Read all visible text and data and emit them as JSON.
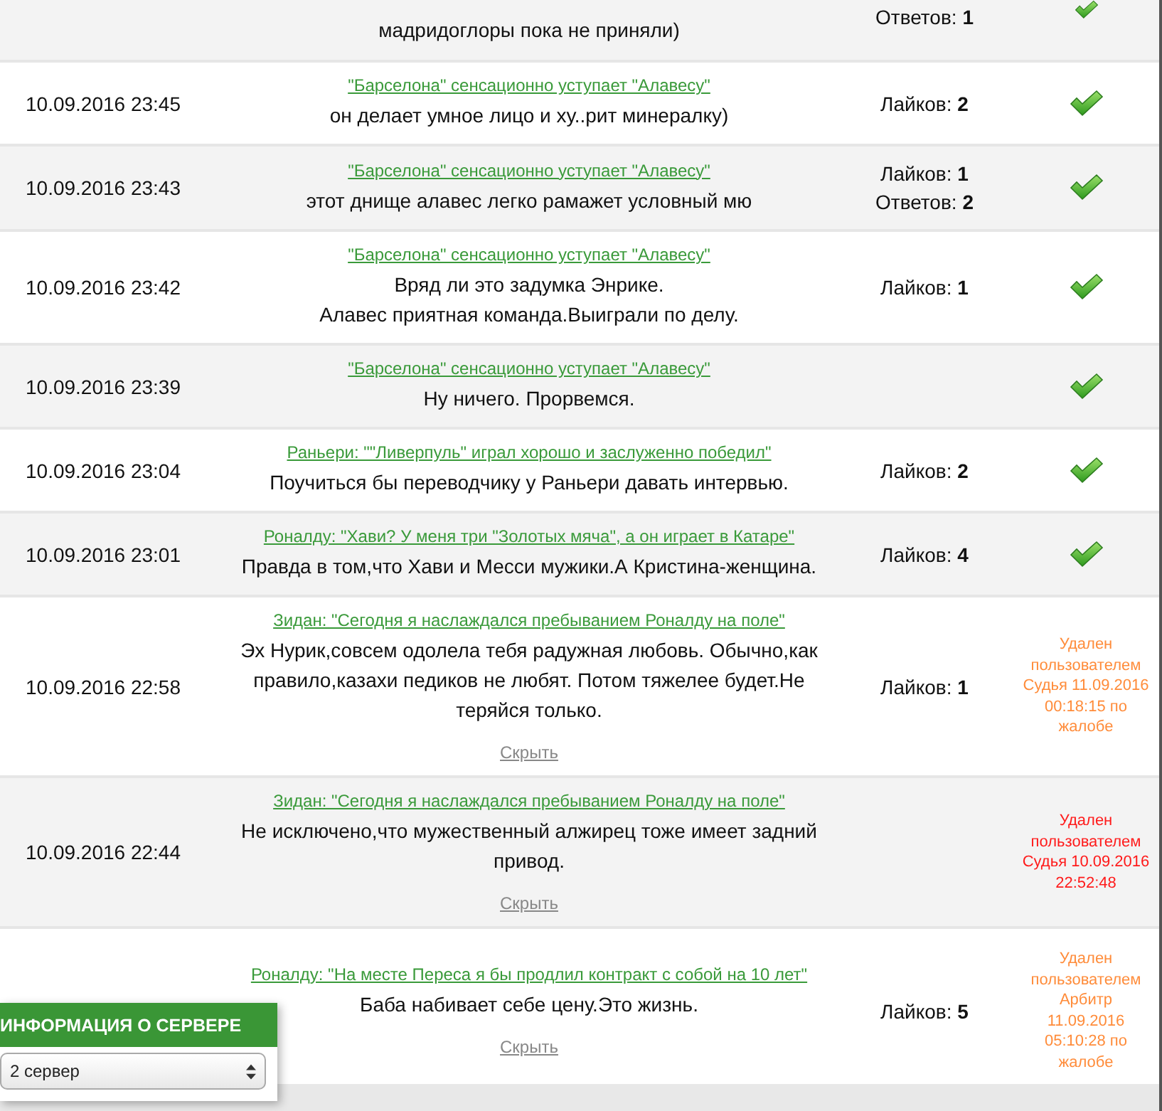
{
  "comments": [
    {
      "text": "мадридоглоры пока не приняли)",
      "stats": [
        {
          "label": "Ответов:",
          "value": "1"
        }
      ],
      "status": {
        "kind": "approved"
      },
      "partial": true
    },
    {
      "date": "10.09.2016 23:45",
      "topic": "\"Барселона\" сенсационно уступает \"Алавесу\"",
      "text": "он делает умное лицо и ху..рит минералку)",
      "stats": [
        {
          "label": "Лайков:",
          "value": "2"
        }
      ],
      "status": {
        "kind": "approved"
      }
    },
    {
      "date": "10.09.2016 23:43",
      "topic": "\"Барселона\" сенсационно уступает \"Алавесу\"",
      "text": "этот днище алавес легко рамажет условный мю",
      "stats": [
        {
          "label": "Лайков:",
          "value": "1"
        },
        {
          "label": "Ответов:",
          "value": "2"
        }
      ],
      "status": {
        "kind": "approved"
      }
    },
    {
      "date": "10.09.2016 23:42",
      "topic": "\"Барселона\" сенсационно уступает \"Алавесу\"",
      "text": "Вряд ли это задумка Энрике.\nАлавес приятная команда.Выиграли по делу.",
      "stats": [
        {
          "label": "Лайков:",
          "value": "1"
        }
      ],
      "status": {
        "kind": "approved"
      }
    },
    {
      "date": "10.09.2016 23:39",
      "topic": "\"Барселона\" сенсационно уступает \"Алавесу\"",
      "text": "Ну ничего. Прорвемся.",
      "status": {
        "kind": "approved"
      }
    },
    {
      "date": "10.09.2016 23:04",
      "topic": "Раньери: \"\"Ливерпуль\" играл хорошо и заслуженно победил\"",
      "text": "Поучиться бы переводчику у Раньери давать интервью.",
      "stats": [
        {
          "label": "Лайков:",
          "value": "2"
        }
      ],
      "status": {
        "kind": "approved"
      }
    },
    {
      "date": "10.09.2016 23:01",
      "topic": "Роналду: \"Хави? У меня три \"Золотых мяча\", а он играет в Катаре\"",
      "text": "Правда в том,что Хави и Месси мужики.А Кристина-женщина.",
      "stats": [
        {
          "label": "Лайков:",
          "value": "4"
        }
      ],
      "status": {
        "kind": "approved"
      }
    },
    {
      "date": "10.09.2016 22:58",
      "topic": "Зидан: \"Сегодня я наслаждался пребыванием Роналду на поле\"",
      "text": "Эх Нурик,совсем одолела тебя радужная любовь. Обычно,как правило,казахи педиков не любят. Потом тяжелее будет.Не теряйся только.",
      "hide": "Скрыть",
      "stats": [
        {
          "label": "Лайков:",
          "value": "1"
        }
      ],
      "status": {
        "kind": "deleted",
        "text": "Удален пользователем Судья 11.09.2016 00:18:15 по жалобе",
        "color": "#ff8c3a"
      }
    },
    {
      "date": "10.09.2016 22:44",
      "topic": "Зидан: \"Сегодня я наслаждался пребыванием Роналду на поле\"",
      "text": "Не исключено,что мужественный алжирец тоже имеет задний привод.",
      "hide": "Скрыть",
      "status": {
        "kind": "deleted",
        "text": "Удален пользователем Судья 10.09.2016 22:52:48",
        "color": "#ff1a1a"
      }
    },
    {
      "topic": "Роналду: \"На месте Переса я бы продлил контракт с собой на 10 лет\"",
      "text": "Баба набивает себе цену.Это жизнь.",
      "hide": "Скрыть",
      "stats": [
        {
          "label": "Лайков:",
          "value": "5"
        }
      ],
      "status": {
        "kind": "deleted",
        "text": "Удален пользователем Арбитр 11.09.2016 05:10:28 по жалобе",
        "color": "#ff8c3a"
      }
    }
  ],
  "server_widget": {
    "title": "ИНФОРМАЦИЯ О СЕРВЕРЕ",
    "select": "2 сервер"
  }
}
